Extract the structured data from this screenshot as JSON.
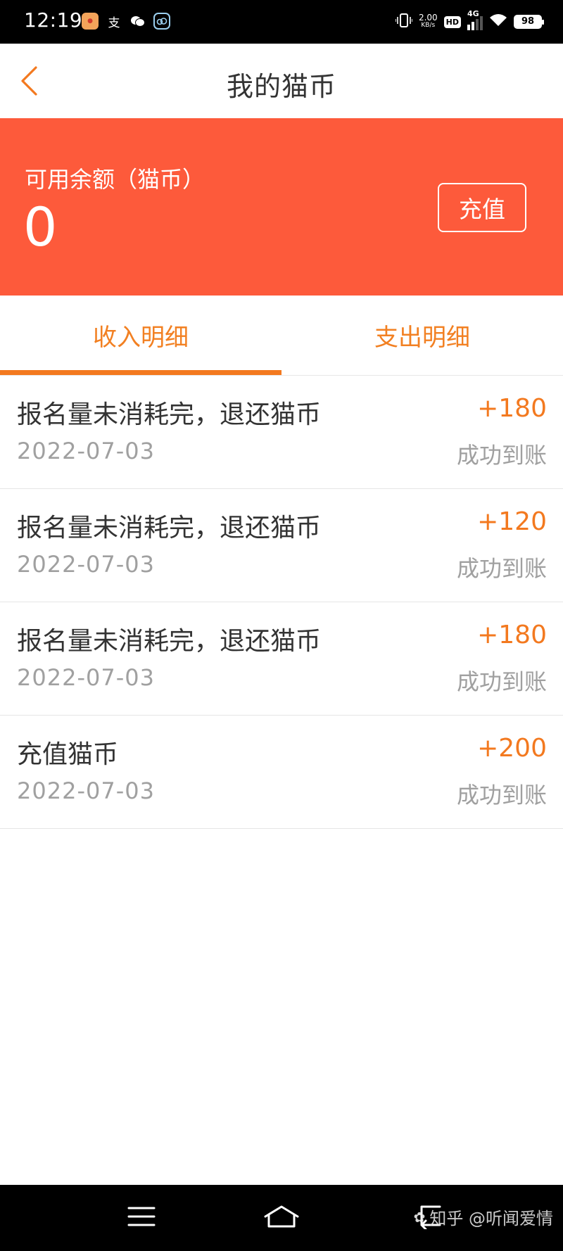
{
  "status_bar": {
    "time": "12:19",
    "app_icons": [
      "taobao-icon",
      "alipay-icon",
      "wechat-icon",
      "cloud-app-icon"
    ],
    "alipay_glyph": "支",
    "net_speed_value": "2.00",
    "net_speed_unit": "KB/s",
    "hd_label": "HD",
    "network_label": "4G",
    "battery": "98"
  },
  "header": {
    "title": "我的猫币",
    "back_icon": "chevron-left-icon"
  },
  "balance": {
    "label": "可用余额（猫币）",
    "value": "0",
    "recharge_label": "充值",
    "background_color": "#fd5a3b"
  },
  "tabs": [
    {
      "label": "收入明细",
      "active": true
    },
    {
      "label": "支出明细",
      "active": false
    }
  ],
  "records": [
    {
      "title": "报名量未消耗完，退还猫币",
      "date": "2022-07-03",
      "amount": "+180",
      "status": "成功到账"
    },
    {
      "title": "报名量未消耗完，退还猫币",
      "date": "2022-07-03",
      "amount": "+120",
      "status": "成功到账"
    },
    {
      "title": "报名量未消耗完，退还猫币",
      "date": "2022-07-03",
      "amount": "+180",
      "status": "成功到账"
    },
    {
      "title": "充值猫币",
      "date": "2022-07-03",
      "amount": "+200",
      "status": "成功到账"
    }
  ],
  "nav_bar": {
    "buttons": [
      "menu-icon",
      "home-icon",
      "back-icon"
    ]
  },
  "watermark": {
    "text": "知乎 @听闻爱情"
  },
  "colors": {
    "accent": "#f3791f",
    "banner": "#fd5a3b",
    "muted_text": "#a0a0a0",
    "primary_text": "#333333"
  }
}
